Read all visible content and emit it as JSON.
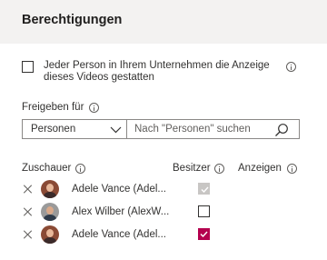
{
  "header": {
    "title": "Berechtigungen"
  },
  "everyone_option": {
    "line1": "Jeder Person in Ihrem Unternehmen die Anzeige",
    "line2": "dieses Videos gestatten",
    "checked": false
  },
  "share": {
    "label": "Freigeben für",
    "dropdown_value": "Personen",
    "search_placeholder": "Nach \"Personen\" suchen"
  },
  "columns": {
    "viewers": "Zuschauer",
    "owner": "Besitzer",
    "display": "Anzeigen"
  },
  "people": [
    {
      "name": "Adele Vance (Adel...",
      "owner": "checked-disabled"
    },
    {
      "name": "Alex Wilber (AlexW...",
      "owner": "unchecked"
    },
    {
      "name": "Adele Vance (Adel...",
      "owner": "checked"
    }
  ],
  "colors": {
    "accent": "#b4004e",
    "header_bg": "#f3f2f1",
    "disabled": "#c8c6c4"
  },
  "icons": [
    "info-icon",
    "chevron-down-icon",
    "search-icon",
    "remove-icon",
    "avatar"
  ]
}
